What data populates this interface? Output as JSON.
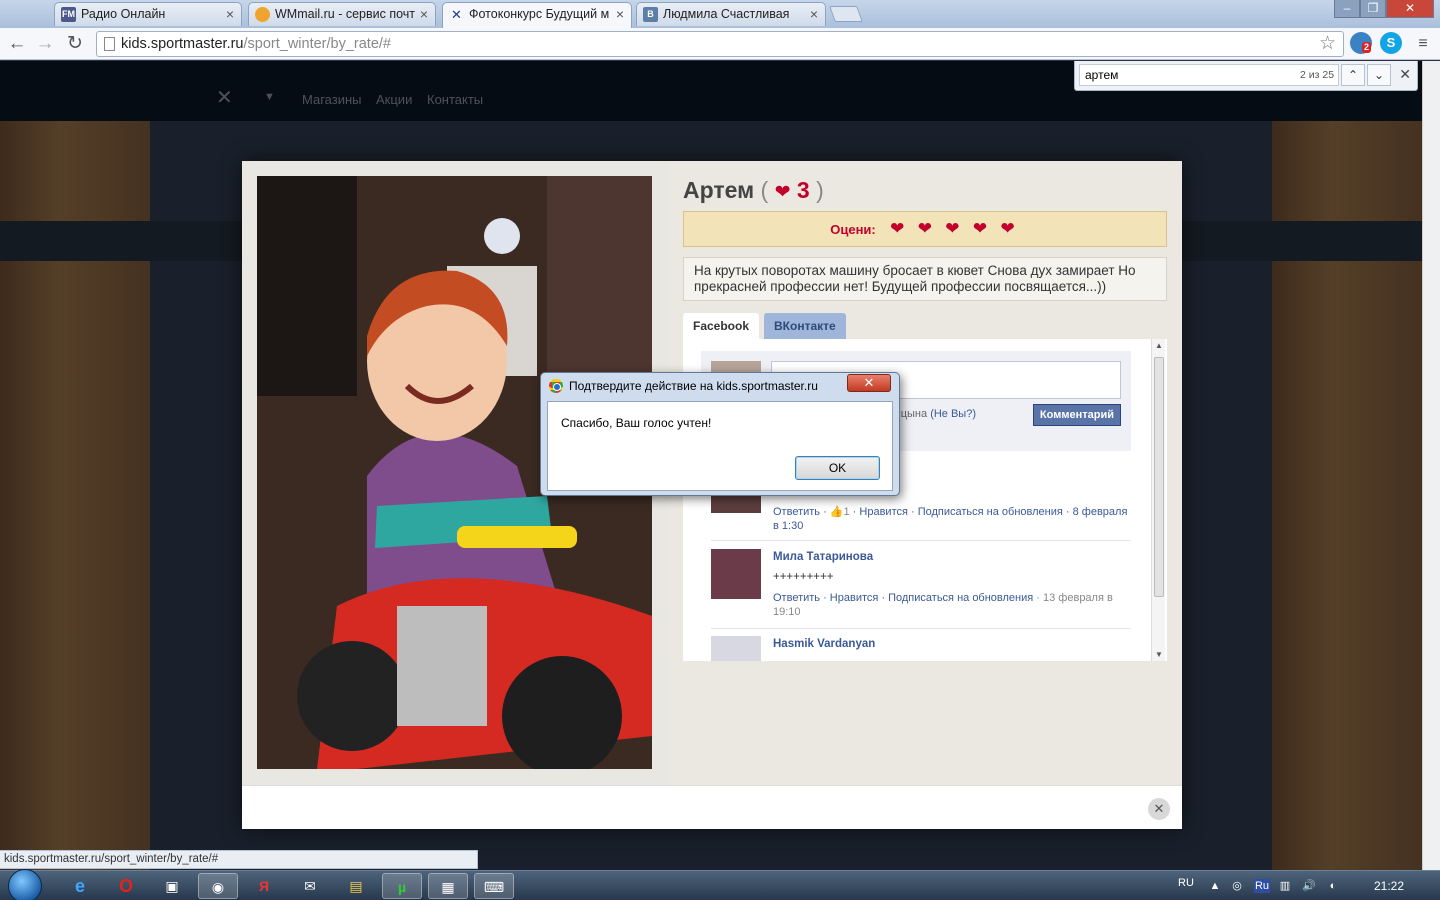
{
  "browser": {
    "tabs": [
      {
        "icon_text": "FM",
        "icon_color": "#4b5a8a",
        "title": "Радио Онлайн"
      },
      {
        "icon_text": "",
        "icon_color": "#f0a430",
        "title": "WMmail.ru - сервис почт"
      },
      {
        "icon_text": "✕",
        "icon_color": "#1d3c8c",
        "title": "Фотоконкурс Будущий м"
      },
      {
        "icon_text": "В",
        "icon_color": "#5b7fa6",
        "title": "Людмила Счастливая"
      }
    ],
    "url_host": "kids.sportmaster.ru",
    "url_path": "/sport_winter/by_rate/#",
    "ext_badge": "2"
  },
  "findbar": {
    "query": "артем",
    "count": "2 из 25"
  },
  "site_nav": {
    "links": [
      "Магазины",
      "Акции",
      "Контакты"
    ]
  },
  "modal": {
    "name": "Артем",
    "votes": "3",
    "rate_label": "Оцени:",
    "description": "На крутых поворотах машину бросает в кювет Снова дух замирает Но прекрасней профессии нет! Будущей профессии посвящается...))",
    "tabs": {
      "facebook": "Facebook",
      "vkontakte": "ВКонтакте"
    },
    "comment_box": {
      "user": "ина Шипицына",
      "not_you": "(Не Вы?)",
      "button": "Комментарий"
    },
    "comments": [
      {
        "name": "",
        "text": "",
        "actions": "Ответить · ",
        "likes": "1",
        "meta": " · Нравится · Подписаться на обновления · 8 февраля в 1:30"
      },
      {
        "name": "Мила Татаринова",
        "text": "+++++++++",
        "actions": "Ответить · Нравится · Подписаться на обновления",
        "meta": " · 13 февраля в 19:10"
      },
      {
        "name": "Hasmik Vardanyan",
        "text": "",
        "actions": "",
        "meta": ""
      }
    ]
  },
  "dialog": {
    "title": "Подтвердите действие на kids.sportmaster.ru",
    "message": "Спасибо, Ваш голос учтен!",
    "ok": "OK"
  },
  "status_url": "kids.sportmaster.ru/sport_winter/by_rate/#",
  "taskbar": {
    "lang": "RU",
    "clock": "21:22",
    "tray_lang": "Ru"
  },
  "colors": {
    "accent": "#c2002b",
    "fb_blue": "#3b5998"
  }
}
